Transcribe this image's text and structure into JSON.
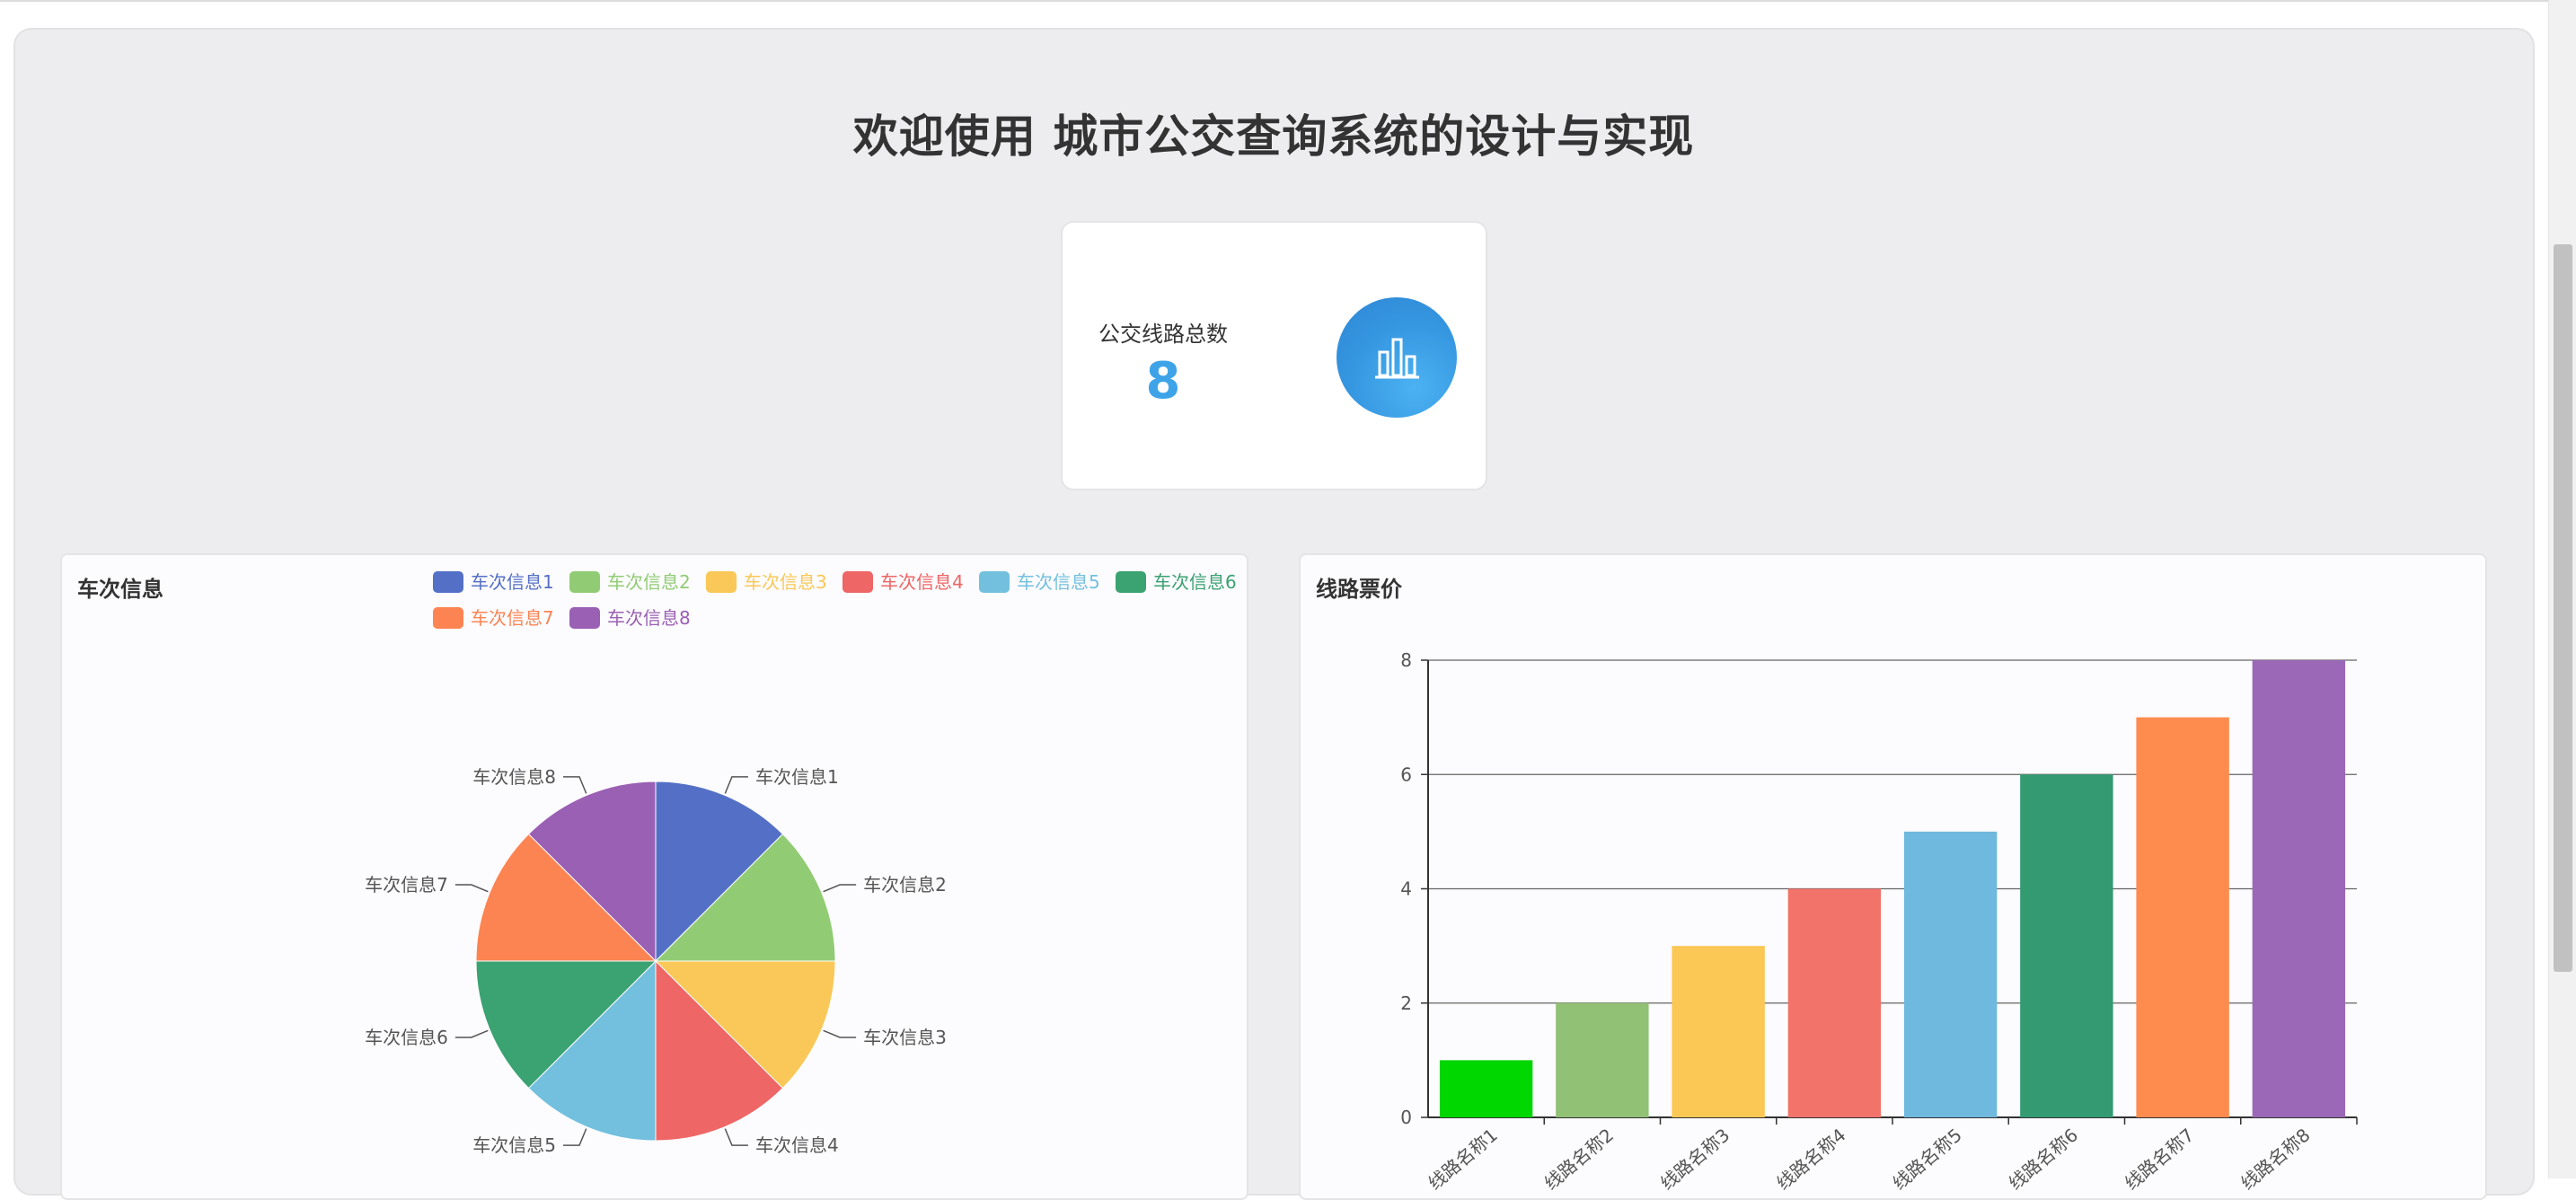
{
  "page": {
    "title": "欢迎使用 城市公交查询系统的设计与实现"
  },
  "stat_card": {
    "label": "公交线路总数",
    "value": "8",
    "icon": "bar-chart-icon",
    "icon_color": "#3596e0"
  },
  "pie_panel": {
    "title": "车次信息"
  },
  "bar_panel": {
    "title": "线路票价"
  },
  "chart_data": [
    {
      "type": "pie",
      "title": "车次信息",
      "legend_position": "top-right",
      "categories": [
        "车次信息1",
        "车次信息2",
        "车次信息3",
        "车次信息4",
        "车次信息5",
        "车次信息6",
        "车次信息7",
        "车次信息8"
      ],
      "values": [
        1,
        1,
        1,
        1,
        1,
        1,
        1,
        1
      ],
      "colors": [
        "#5470c6",
        "#91cc75",
        "#fac858",
        "#ee6666",
        "#73c0de",
        "#3ba272",
        "#fc8452",
        "#9a60b4"
      ]
    },
    {
      "type": "bar",
      "title": "线路票价",
      "categories": [
        "线路名称1",
        "线路名称2",
        "线路名称3",
        "线路名称4",
        "线路名称5",
        "线路名称6",
        "线路名称7",
        "线路名称8"
      ],
      "values": [
        1,
        2,
        3,
        4,
        5,
        6,
        7,
        8
      ],
      "colors": [
        "#00d600",
        "#91c175",
        "#fbc755",
        "#f2736a",
        "#6fb8de",
        "#339a72",
        "#fd8c4e",
        "#9a68b6"
      ],
      "ylim": [
        0,
        8
      ],
      "yticks": [
        "0",
        "2",
        "4",
        "6",
        "8"
      ],
      "grid": true
    }
  ]
}
